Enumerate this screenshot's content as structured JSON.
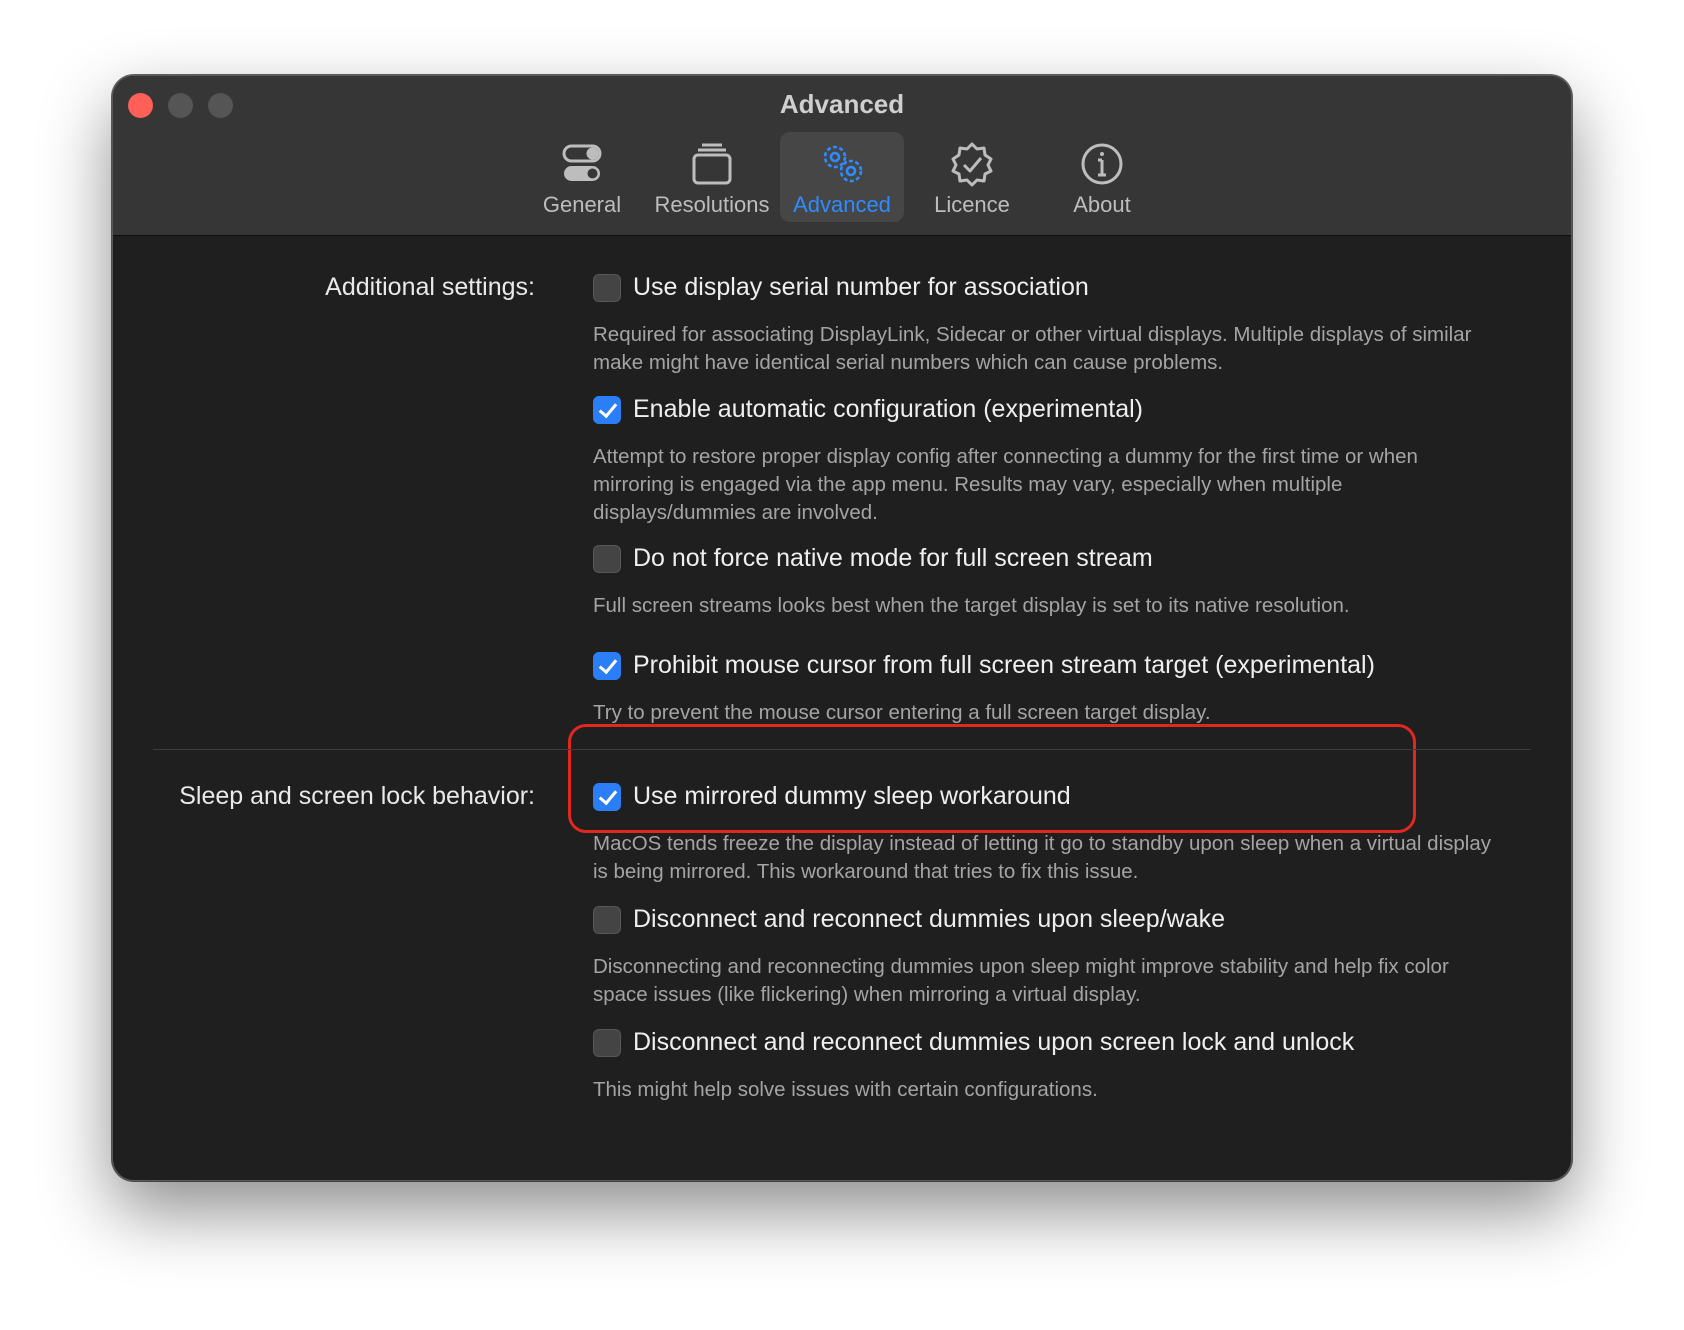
{
  "window": {
    "title": "Advanced"
  },
  "toolbar": {
    "tabs": [
      {
        "label": "General",
        "icon": "toggles-icon",
        "active": false
      },
      {
        "label": "Resolutions",
        "icon": "stacked-windows-icon",
        "active": false
      },
      {
        "label": "Advanced",
        "icon": "gears-icon",
        "active": true
      },
      {
        "label": "Licence",
        "icon": "checkmark-seal-icon",
        "active": false
      },
      {
        "label": "About",
        "icon": "info-circle-icon",
        "active": false
      }
    ]
  },
  "sections": {
    "additional": {
      "label": "Additional settings:",
      "options": [
        {
          "label": "Use display serial number for association",
          "checked": false,
          "description": "Required for associating DisplayLink, Sidecar or other virtual displays. Multiple displays of similar make might have identical serial numbers which can cause problems."
        },
        {
          "label": "Enable automatic configuration (experimental)",
          "checked": true,
          "description": "Attempt to restore proper display config after connecting a dummy for the first time or when mirroring is engaged via the app menu. Results may vary, especially when multiple displays/dummies are involved."
        },
        {
          "label": "Do not force native mode for full screen stream",
          "checked": false,
          "description": "Full screen streams looks best when the target display is set to its native resolution."
        },
        {
          "label": "Prohibit mouse cursor from full screen stream target (experimental)",
          "checked": true,
          "description": "Try to prevent the mouse cursor entering a full screen target display."
        }
      ]
    },
    "sleep": {
      "label": "Sleep and screen lock behavior:",
      "options": [
        {
          "label": "Use mirrored dummy sleep workaround",
          "checked": true,
          "description": "MacOS tends freeze the display instead of letting it go to standby upon sleep when a virtual display is being mirrored. This workaround that tries to fix this issue."
        },
        {
          "label": "Disconnect and reconnect dummies upon sleep/wake",
          "checked": false,
          "description": "Disconnecting and reconnecting dummies upon sleep might improve stability and help fix color space issues (like flickering) when mirroring a virtual display."
        },
        {
          "label": "Disconnect and reconnect dummies upon screen lock and unlock",
          "checked": false,
          "description": "This might help solve issues with certain configurations."
        }
      ]
    }
  },
  "colors": {
    "accent": "#2b7ef5",
    "highlight_border": "#e2271e",
    "window_bg": "#1f1f1f",
    "titlebar_bg": "#363636"
  }
}
